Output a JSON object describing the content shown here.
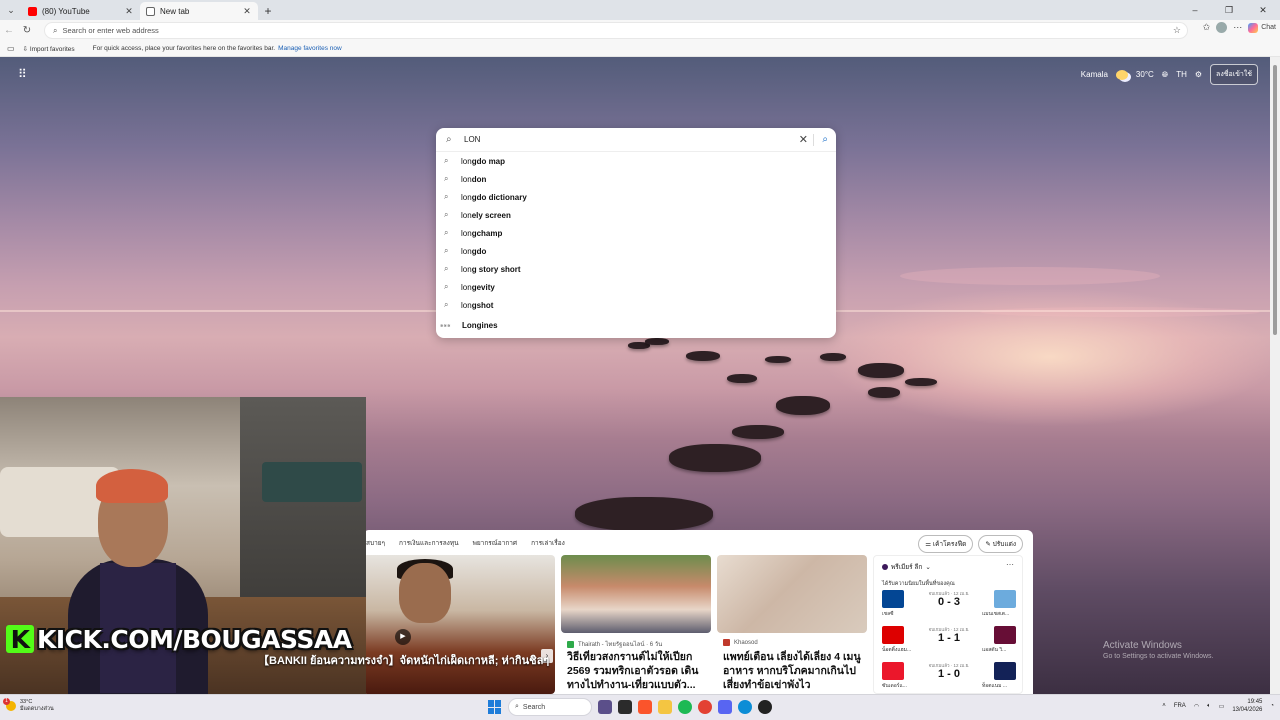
{
  "browser": {
    "tabs": [
      {
        "label": "(80) YouTube",
        "active": false
      },
      {
        "label": "New tab",
        "active": true
      }
    ],
    "address_placeholder": "Search or enter web address",
    "copilot_label": "Chat",
    "favorites": {
      "import_label": "Import favorites",
      "hint": "For quick access, place your favorites here on the favorites bar.",
      "manage_link": "Manage favorites now"
    }
  },
  "ntp": {
    "weather": {
      "location": "Kamala",
      "temp": "30°C"
    },
    "language": "TH",
    "signin_label": "ลงชื่อเข้าใช้"
  },
  "search": {
    "query": "LON",
    "suggestions": [
      {
        "typed": "lon",
        "rest": "gdo map"
      },
      {
        "typed": "lon",
        "rest": "don"
      },
      {
        "typed": "lon",
        "rest": "gdo dictionary"
      },
      {
        "typed": "lon",
        "rest": "ely screen"
      },
      {
        "typed": "lon",
        "rest": "gchamp"
      },
      {
        "typed": "lon",
        "rest": "gdo"
      },
      {
        "typed": "lon",
        "rest": "g story short"
      },
      {
        "typed": "lon",
        "rest": "gevity"
      },
      {
        "typed": "lon",
        "rest": "gshot"
      }
    ],
    "brand_suggestion": "Longines"
  },
  "feed": {
    "nav": [
      "สบายๆ",
      "การเงินและการลงทุน",
      "พยากรณ์อากาศ",
      "การเล่าเรื่อง"
    ],
    "actions": {
      "personalize": "เค้าโครงฟีด",
      "customize": "ปรับแต่ง"
    },
    "video_title": "【BANKII ย้อนความทรงจำ】จัดหนักไก่เผ็ดเกาหลี; ห่ากินชิลๆ",
    "cards": [
      {
        "source": "Thairath - ไทยรัฐออนไลน์ · 6 วัน",
        "title": "วิธีเที่ยวสงกรานต์ไม่ให้เปียก 2569 รวมทริกเอาตัวรอด เดินทางไปทำงาน-เที่ยวแบบตัว...",
        "source_color": "#2eaa4a"
      },
      {
        "source": "Khaosod",
        "title": "แพทย์เตือน เลี่ยงได้เลี่ยง 4 เมนูอาหาร หากบริโภคมากเกินไป เสี่ยงทำข้อเข่าพังไว",
        "source_color": "#c0392b"
      }
    ],
    "sports": {
      "league": "พรีเมียร์ ลีก",
      "subtitle": "ได้รับความนิยมในพื้นที่ของคุณ",
      "matches": [
        {
          "status": "จบเกมแล้ว · 12 เม.ย.",
          "score": "0 - 3",
          "home": "เชลซี",
          "away": "แมนเชสเต...",
          "home_color": "#034694",
          "away_color": "#6cabdd"
        },
        {
          "status": "จบเกมแล้ว · 12 เม.ย.",
          "score": "1 - 1",
          "home": "น็อตติ้งแฮม...",
          "away": "แอสตัน วิ...",
          "home_color": "#dd0000",
          "away_color": "#670e36"
        },
        {
          "status": "จบเกมแล้ว · 12 เม.ย.",
          "score": "1 - 0",
          "home": "ซันเดอร์แ...",
          "away": "ท็อตแนม ...",
          "home_color": "#eb172b",
          "away_color": "#132257"
        }
      ]
    }
  },
  "overlay": {
    "kick_text": "KICK.COM/BOUGASSAA",
    "activate_title": "Activate Windows",
    "activate_sub": "Go to Settings to activate Windows."
  },
  "taskbar": {
    "weather_temp": "33°C",
    "weather_desc": "มีแดดบางส่วน",
    "weather_badge": "1",
    "search_label": "Search",
    "lang": "FRA",
    "time": "19:45",
    "date": "13/04/2026"
  }
}
